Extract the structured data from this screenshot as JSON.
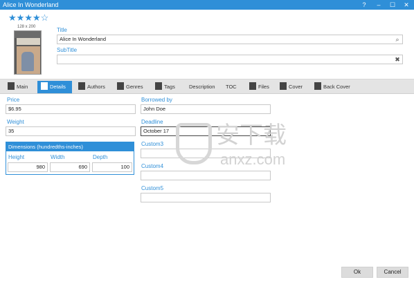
{
  "window": {
    "title": "Alice In Wonderland",
    "help": "?",
    "minimize": "–",
    "maximize": "☐",
    "close": "✕"
  },
  "rating": {
    "value": 4,
    "max": 5,
    "filled": "★",
    "empty": "☆"
  },
  "cover": {
    "size_label": "128 x 200"
  },
  "title_field": {
    "label": "Title",
    "value": "Alice In Wonderland",
    "icon": "search-icon"
  },
  "subtitle_field": {
    "label": "SubTitle",
    "value": "",
    "icon": "pin-icon"
  },
  "tabs": [
    {
      "label": "Main",
      "icon": "main-icon"
    },
    {
      "label": "Details",
      "icon": "details-icon",
      "active": true
    },
    {
      "label": "Authors",
      "icon": "authors-icon"
    },
    {
      "label": "Genres",
      "icon": "genres-icon"
    },
    {
      "label": "Tags",
      "icon": "tags-icon"
    },
    {
      "label": "Description"
    },
    {
      "label": "TOC"
    },
    {
      "label": "Files",
      "icon": "files-icon"
    },
    {
      "label": "Cover",
      "icon": "cover-icon"
    },
    {
      "label": "Back Cover",
      "icon": "back-cover-icon"
    }
  ],
  "details": {
    "price": {
      "label": "Price",
      "value": "$6.95"
    },
    "weight": {
      "label": "Weight",
      "value": "35"
    },
    "dimensions": {
      "title": "Dimensions (hundredths-inches)",
      "height": {
        "label": "Height",
        "value": "980"
      },
      "width": {
        "label": "Width",
        "value": "690"
      },
      "depth": {
        "label": "Depth",
        "value": "100"
      }
    },
    "borrowed_by": {
      "label": "Borrowed by",
      "value": "John Doe"
    },
    "deadline": {
      "label": "Deadline",
      "value": "October 17"
    },
    "custom3": {
      "label": "Custom3",
      "value": ""
    },
    "custom4": {
      "label": "Custom4",
      "value": ""
    },
    "custom5": {
      "label": "Custom5",
      "value": ""
    }
  },
  "watermark": {
    "text": "安下载",
    "domain": "anxz.com"
  },
  "buttons": {
    "ok": "Ok",
    "cancel": "Cancel"
  },
  "colors": {
    "accent": "#2f8fd8",
    "tabbar": "#e4e4e4",
    "button": "#dcdcdc"
  }
}
